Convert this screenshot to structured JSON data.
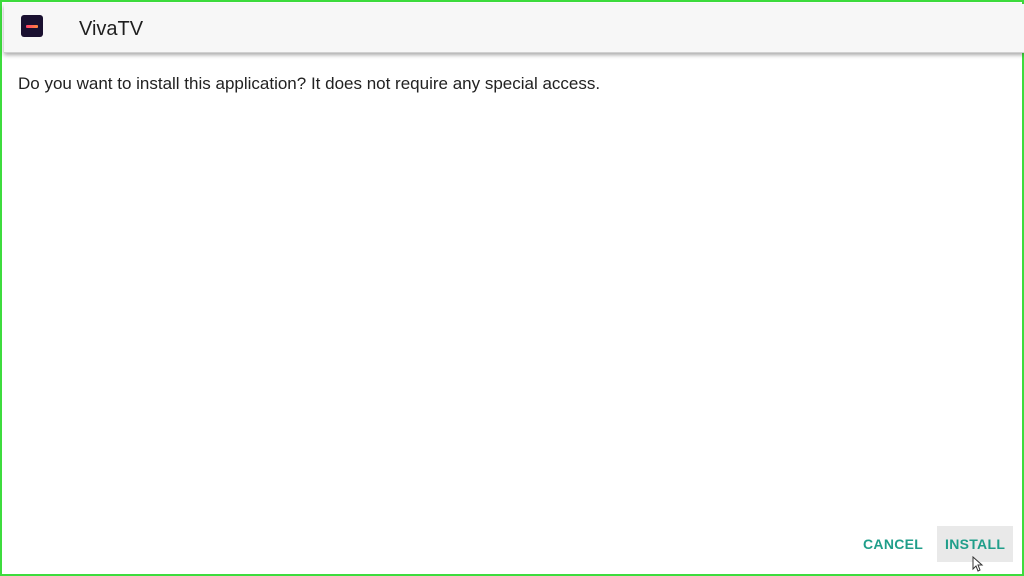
{
  "header": {
    "app_name": "VivaTV",
    "icon": "vivatv-app-icon"
  },
  "content": {
    "prompt": "Do you want to install this application? It does not require any special access."
  },
  "actions": {
    "cancel_label": "CANCEL",
    "install_label": "INSTALL",
    "focused": "install"
  },
  "colors": {
    "frame_border": "#3ddc3d",
    "accent": "#1f9e8a",
    "header_bg": "#f7f7f7",
    "focused_button_bg": "#e9e9e9"
  },
  "cursor": {
    "icon": "mouse-pointer-icon"
  }
}
